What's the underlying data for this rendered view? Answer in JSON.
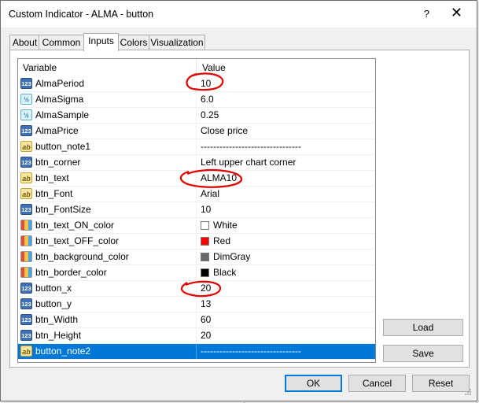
{
  "window": {
    "title": "Custom Indicator - ALMA  - button",
    "help": "?",
    "close": "✕"
  },
  "tabs": [
    {
      "label": "About",
      "active": false
    },
    {
      "label": "Common",
      "active": false
    },
    {
      "label": "Inputs",
      "active": true
    },
    {
      "label": "Colors",
      "active": false
    },
    {
      "label": "Visualization",
      "active": false
    }
  ],
  "grid": {
    "columns": [
      "Variable",
      "Value"
    ],
    "rows": [
      {
        "type": "int",
        "icon_text": "123",
        "name": "AlmaPeriod",
        "value": "10"
      },
      {
        "type": "dbl",
        "icon_text": "½",
        "name": "AlmaSigma",
        "value": "6.0"
      },
      {
        "type": "dbl",
        "icon_text": "½",
        "name": "AlmaSample",
        "value": "0.25"
      },
      {
        "type": "int",
        "icon_text": "123",
        "name": "AlmaPrice",
        "value": "Close price"
      },
      {
        "type": "str",
        "icon_text": "ab",
        "name": "button_note1",
        "value": "--------------------------------"
      },
      {
        "type": "int",
        "icon_text": "123",
        "name": "btn_corner",
        "value": "Left upper chart corner"
      },
      {
        "type": "str",
        "icon_text": "ab",
        "name": "btn_text",
        "value": "ALMA10"
      },
      {
        "type": "str",
        "icon_text": "ab",
        "name": "btn_Font",
        "value": "Arial"
      },
      {
        "type": "int",
        "icon_text": "123",
        "name": "btn_FontSize",
        "value": "10"
      },
      {
        "type": "clr",
        "icon_text": "",
        "name": "btn_text_ON_color",
        "value": "White",
        "swatch": "#ffffff"
      },
      {
        "type": "clr",
        "icon_text": "",
        "name": "btn_text_OFF_color",
        "value": "Red",
        "swatch": "#ff0000"
      },
      {
        "type": "clr",
        "icon_text": "",
        "name": "btn_background_color",
        "value": "DimGray",
        "swatch": "#696969"
      },
      {
        "type": "clr",
        "icon_text": "",
        "name": "btn_border_color",
        "value": "Black",
        "swatch": "#000000"
      },
      {
        "type": "int",
        "icon_text": "123",
        "name": "button_x",
        "value": "20"
      },
      {
        "type": "int",
        "icon_text": "123",
        "name": "button_y",
        "value": "13"
      },
      {
        "type": "int",
        "icon_text": "123",
        "name": "btn_Width",
        "value": "60"
      },
      {
        "type": "int",
        "icon_text": "123",
        "name": "btn_Height",
        "value": "20"
      },
      {
        "type": "str",
        "icon_text": "ab",
        "name": "button_note2",
        "value": "--------------------------------",
        "selected": true
      }
    ]
  },
  "side_buttons": {
    "load": "Load",
    "save": "Save"
  },
  "footer": {
    "ok": "OK",
    "cancel": "Cancel",
    "reset": "Reset"
  },
  "colors": {
    "accent": "#0078d7",
    "annotation": "#e00000"
  }
}
